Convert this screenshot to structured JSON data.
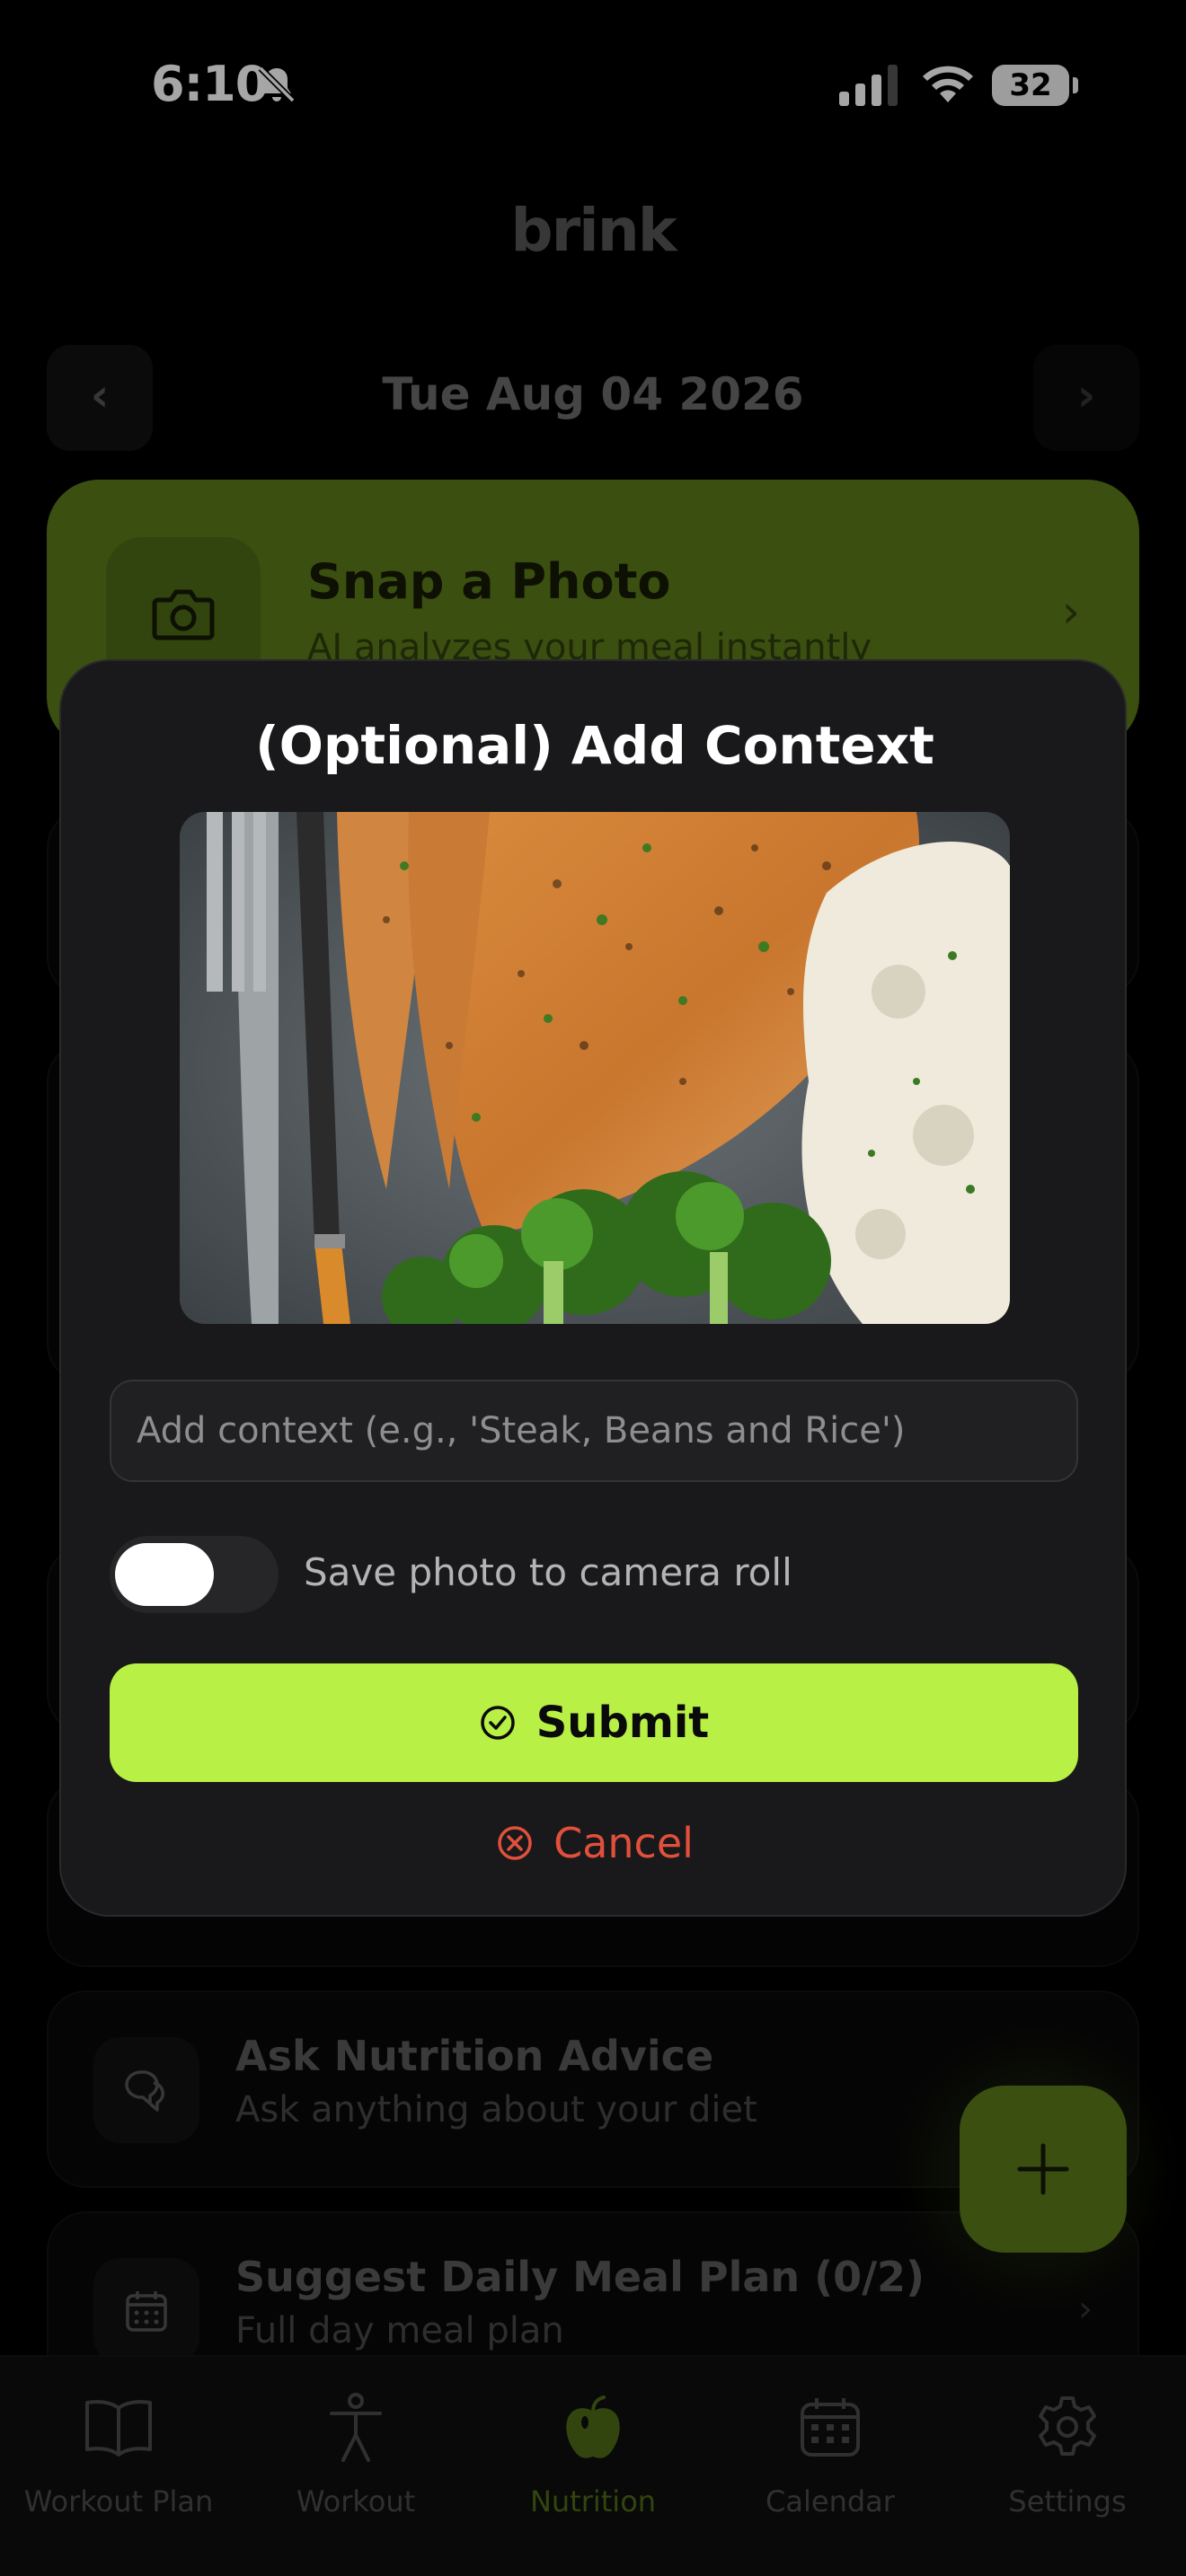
{
  "status_bar": {
    "time": "6:10",
    "battery": "32",
    "icons": [
      "bell-slash-icon",
      "signal-icon",
      "wifi-icon",
      "battery-icon"
    ]
  },
  "app": {
    "logo": "brink"
  },
  "date_nav": {
    "prev": "‹",
    "date": "Tue Aug 04 2026",
    "next": "›"
  },
  "snap_card": {
    "title": "Snap a Photo",
    "subtitle": "AI analyzes your meal instantly",
    "chevron": "›",
    "icon": "camera-icon"
  },
  "feature_cards": [
    {
      "title": "Ask Nutrition Advice",
      "subtitle": "Ask anything about your diet",
      "icon": "chat-bubbles-icon",
      "chevron": ""
    },
    {
      "title": "Suggest Daily Meal Plan (0/2)",
      "subtitle": "Full day meal plan",
      "icon": "calendar-icon",
      "chevron": "›"
    }
  ],
  "fab": {
    "icon": "plus-icon"
  },
  "tabs": [
    {
      "label": "Workout Plan",
      "icon": "book-icon",
      "active": false
    },
    {
      "label": "Workout",
      "icon": "person-icon",
      "active": false
    },
    {
      "label": "Nutrition",
      "icon": "apple-icon",
      "active": true
    },
    {
      "label": "Calendar",
      "icon": "calendar-icon",
      "active": false
    },
    {
      "label": "Settings",
      "icon": "gear-icon",
      "active": false
    }
  ],
  "modal": {
    "title": "(Optional) Add Context",
    "photo_alt": "meal photo",
    "context_placeholder": "Add context (e.g., 'Steak, Beans and Rice')",
    "context_value": "",
    "save_toggle_label": "Save photo to camera roll",
    "save_toggle_on": false,
    "submit_label": "Submit",
    "cancel_label": "Cancel"
  },
  "colors": {
    "accent": "#b8f045",
    "accent_dim": "#5a7a1a",
    "danger": "#e2503c",
    "modal_bg": "#19191b"
  }
}
